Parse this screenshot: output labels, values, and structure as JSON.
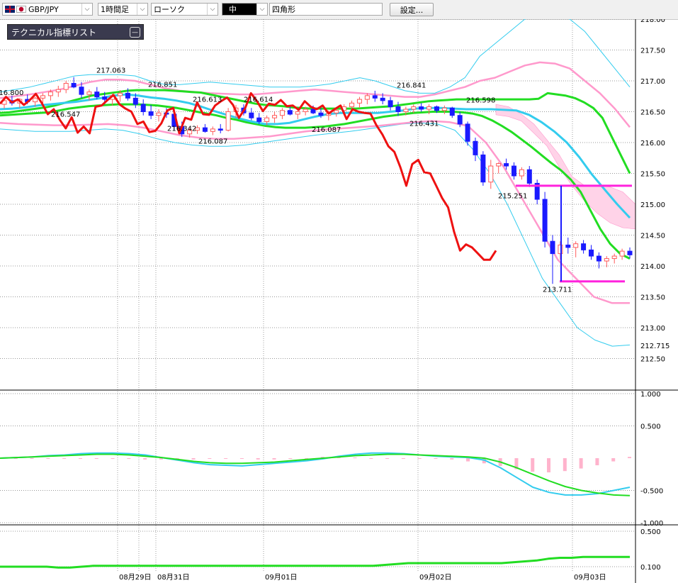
{
  "toolbar": {
    "symbol": "GBP/JPY",
    "timeframe": "1時間足",
    "chart_type": "ローソク",
    "line_style": "中",
    "drawing_tool": "四角形",
    "settings_label": "設定..."
  },
  "indicator_panel": {
    "label": "テクニカル指標リスト"
  },
  "colors": {
    "bull_candle": "#ff5a5a",
    "bear_candle": "#1a1aff",
    "red_line": "#ee1111",
    "green_line": "#22dd22",
    "cyan_line": "#33ccee",
    "pink_band": "#ff99cc",
    "magenta_marker": "#ff22dd"
  },
  "chart_data": [
    {
      "type": "candlestick",
      "title": "",
      "ylim": [
        212.5,
        218.2
      ],
      "y_ticks": [
        "218.00",
        "217.50",
        "217.00",
        "216.50",
        "216.00",
        "215.50",
        "215.00",
        "214.50",
        "214.00",
        "213.50",
        "213.00",
        "212.50"
      ],
      "current_price_label": "212.715",
      "x_labels": [
        "08月29日",
        "08月31日",
        "09月01日",
        "09月02日",
        "09月03日"
      ],
      "price_labels": [
        "216.800",
        "217.063",
        "216.547",
        "216.851",
        "216.342",
        "216.613",
        "216.087",
        "216.614",
        "216.087",
        "216.841",
        "216.431",
        "216.598",
        "215.251",
        "213.711"
      ],
      "candles": [
        [
          216.62,
          216.7,
          216.55,
          216.68
        ],
        [
          216.68,
          216.76,
          216.6,
          216.64
        ],
        [
          216.64,
          216.72,
          216.56,
          216.7
        ],
        [
          216.7,
          216.78,
          216.62,
          216.66
        ],
        [
          216.66,
          216.74,
          216.58,
          216.72
        ],
        [
          216.72,
          216.8,
          216.64,
          216.76
        ],
        [
          216.76,
          216.86,
          216.68,
          216.82
        ],
        [
          216.82,
          216.92,
          216.74,
          216.86
        ],
        [
          216.86,
          217.0,
          216.8,
          216.96
        ],
        [
          216.96,
          217.06,
          216.88,
          216.9
        ],
        [
          216.9,
          216.98,
          216.72,
          216.78
        ],
        [
          216.78,
          216.86,
          216.68,
          216.82
        ],
        [
          216.82,
          216.9,
          216.7,
          216.74
        ],
        [
          216.74,
          216.82,
          216.62,
          216.7
        ],
        [
          216.7,
          216.8,
          216.6,
          216.76
        ],
        [
          216.76,
          216.85,
          216.66,
          216.8
        ],
        [
          216.8,
          216.88,
          216.68,
          216.72
        ],
        [
          216.72,
          216.8,
          216.56,
          216.62
        ],
        [
          216.62,
          216.7,
          216.44,
          216.5
        ],
        [
          216.5,
          216.61,
          216.38,
          216.44
        ],
        [
          216.44,
          216.54,
          216.34,
          216.48
        ],
        [
          216.48,
          216.56,
          216.4,
          216.46
        ],
        [
          216.46,
          216.52,
          216.2,
          216.26
        ],
        [
          216.26,
          216.34,
          216.09,
          216.14
        ],
        [
          216.14,
          216.24,
          216.08,
          216.2
        ],
        [
          216.2,
          216.28,
          216.14,
          216.24
        ],
        [
          216.24,
          216.3,
          216.16,
          216.18
        ],
        [
          216.18,
          216.26,
          216.12,
          216.22
        ],
        [
          216.22,
          216.3,
          216.15,
          216.2
        ],
        [
          216.2,
          216.56,
          216.18,
          216.5
        ],
        [
          216.5,
          216.61,
          216.4,
          216.56
        ],
        [
          216.56,
          216.62,
          216.44,
          216.48
        ],
        [
          216.48,
          216.56,
          216.36,
          216.4
        ],
        [
          216.4,
          216.48,
          216.3,
          216.34
        ],
        [
          216.34,
          216.44,
          216.28,
          216.4
        ],
        [
          216.4,
          216.5,
          216.32,
          216.44
        ],
        [
          216.44,
          216.56,
          216.38,
          216.52
        ],
        [
          216.52,
          216.6,
          216.44,
          216.46
        ],
        [
          216.46,
          216.54,
          216.38,
          216.5
        ],
        [
          216.5,
          216.58,
          216.44,
          216.54
        ],
        [
          216.54,
          216.6,
          216.46,
          216.48
        ],
        [
          216.48,
          216.56,
          216.4,
          216.44
        ],
        [
          216.44,
          216.52,
          216.36,
          216.48
        ],
        [
          216.48,
          216.56,
          216.42,
          216.52
        ],
        [
          216.52,
          216.62,
          216.46,
          216.58
        ],
        [
          216.58,
          216.68,
          216.5,
          216.64
        ],
        [
          216.64,
          216.74,
          216.56,
          216.7
        ],
        [
          216.7,
          216.8,
          216.62,
          216.76
        ],
        [
          216.76,
          216.84,
          216.66,
          216.72
        ],
        [
          216.72,
          216.8,
          216.62,
          216.68
        ],
        [
          216.68,
          216.74,
          216.52,
          216.58
        ],
        [
          216.58,
          216.66,
          216.43,
          216.5
        ],
        [
          216.5,
          216.58,
          216.44,
          216.54
        ],
        [
          216.54,
          216.62,
          216.48,
          216.58
        ],
        [
          216.58,
          216.64,
          216.5,
          216.54
        ],
        [
          216.54,
          216.62,
          216.46,
          216.58
        ],
        [
          216.58,
          216.6,
          216.48,
          216.52
        ],
        [
          216.52,
          216.6,
          216.46,
          216.56
        ],
        [
          216.56,
          216.58,
          216.4,
          216.44
        ],
        [
          216.44,
          216.5,
          216.25,
          216.3
        ],
        [
          216.3,
          216.34,
          215.95,
          216.02
        ],
        [
          216.02,
          216.08,
          215.7,
          215.8
        ],
        [
          215.8,
          215.86,
          215.3,
          215.36
        ],
        [
          215.36,
          215.72,
          215.25,
          215.62
        ],
        [
          215.62,
          215.68,
          215.5,
          215.66
        ],
        [
          215.66,
          215.74,
          215.56,
          215.62
        ],
        [
          215.62,
          215.68,
          215.4,
          215.46
        ],
        [
          215.46,
          215.6,
          215.4,
          215.56
        ],
        [
          215.56,
          215.62,
          215.28,
          215.34
        ],
        [
          215.34,
          215.4,
          215.0,
          215.08
        ],
        [
          215.08,
          215.2,
          214.3,
          214.4
        ],
        [
          214.4,
          214.5,
          213.71,
          214.2
        ],
        [
          214.2,
          214.4,
          214.1,
          214.34
        ],
        [
          214.34,
          214.46,
          214.2,
          214.3
        ],
        [
          214.3,
          214.4,
          214.14,
          214.36
        ],
        [
          214.36,
          214.42,
          214.2,
          214.26
        ],
        [
          214.26,
          214.34,
          214.1,
          214.16
        ],
        [
          214.16,
          214.22,
          213.96,
          214.08
        ],
        [
          214.08,
          214.16,
          213.98,
          214.12
        ],
        [
          214.12,
          214.2,
          214.04,
          214.16
        ],
        [
          214.16,
          214.28,
          214.1,
          214.24
        ],
        [
          214.24,
          214.3,
          214.12,
          214.18
        ]
      ],
      "red_line": [
        216.63,
        216.74,
        216.65,
        216.7,
        216.61,
        216.69,
        216.79,
        216.64,
        216.46,
        216.54,
        216.37,
        216.23,
        216.41,
        216.16,
        216.26,
        216.15,
        216.58,
        216.6,
        216.69,
        216.77,
        216.62,
        216.55,
        216.5,
        216.3,
        216.34,
        216.17,
        216.19,
        216.31,
        216.52,
        216.56,
        216.15,
        216.4,
        216.37,
        216.65,
        216.46,
        216.45,
        216.6,
        216.67,
        216.73,
        216.61,
        216.4,
        216.55,
        216.8,
        216.67,
        216.51,
        216.63,
        216.61,
        216.69,
        216.59,
        216.6,
        216.53,
        216.67,
        216.58,
        216.54,
        216.6,
        216.47,
        216.54,
        216.6,
        216.38,
        216.54,
        216.5,
        216.48,
        216.47,
        216.28,
        216.13,
        215.94,
        215.85,
        215.6,
        215.3,
        215.65,
        215.72,
        215.52,
        215.5,
        215.3,
        215.1,
        214.95,
        214.55,
        214.25,
        214.35,
        214.3,
        214.2,
        214.1,
        214.1,
        214.25
      ],
      "green_line_1": [
        216.48,
        216.49,
        216.51,
        216.53,
        216.55,
        216.57,
        216.6,
        216.64,
        216.68,
        216.72,
        216.76,
        216.78,
        216.8,
        216.82,
        216.84,
        216.85,
        216.85,
        216.85,
        216.85,
        216.84,
        216.83,
        216.82,
        216.81,
        216.78,
        216.75,
        216.72,
        216.69,
        216.66,
        216.63,
        216.61,
        216.6,
        216.59,
        216.57,
        216.56,
        216.55,
        216.55,
        216.55,
        216.55,
        216.55,
        216.55,
        216.56,
        216.57,
        216.58,
        216.59,
        216.61,
        216.63,
        216.65,
        216.67,
        216.68,
        216.69,
        216.7,
        216.7,
        216.7,
        216.7,
        216.7,
        216.7,
        216.7,
        216.7,
        216.7,
        216.71,
        216.8,
        216.78,
        216.76,
        216.72,
        216.65,
        216.56,
        216.4,
        216.1,
        215.8,
        215.5
      ],
      "green_line_2": [
        216.44,
        216.45,
        216.46,
        216.47,
        216.48,
        216.49,
        216.52,
        216.55,
        216.57,
        216.59,
        216.6,
        216.61,
        216.62,
        216.62,
        216.62,
        216.61,
        216.6,
        216.58,
        216.56,
        216.53,
        216.5,
        216.47,
        216.44,
        216.4,
        216.37,
        216.33,
        216.3,
        216.27,
        216.25,
        216.24,
        216.24,
        216.24,
        216.25,
        216.26,
        216.28,
        216.3,
        216.33,
        216.36,
        216.39,
        216.42,
        216.44,
        216.46,
        216.48,
        216.49,
        216.5,
        216.5,
        216.5,
        216.49,
        216.47,
        216.43,
        216.36,
        216.27,
        216.17,
        216.05,
        215.93,
        215.8,
        215.67,
        215.55,
        215.4,
        215.2,
        214.9,
        214.6,
        214.36,
        214.2,
        214.12
      ],
      "cyan_line": [
        216.54,
        216.55,
        216.57,
        216.6,
        216.62,
        216.64,
        216.66,
        216.69,
        216.72,
        216.76,
        216.78,
        216.76,
        216.73,
        216.71,
        216.68,
        216.64,
        216.58,
        216.51,
        216.45,
        216.39,
        216.34,
        216.3,
        216.3,
        216.32,
        216.37,
        216.42,
        216.46,
        216.48,
        216.48,
        216.48,
        216.48,
        216.5,
        216.52,
        216.55,
        216.56,
        216.56,
        216.55,
        216.54,
        216.54,
        216.54,
        216.53,
        216.52,
        216.45,
        216.33,
        216.18,
        216.0,
        215.76,
        215.48,
        215.24,
        215.0,
        214.78
      ],
      "bb_upper_cyan": [
        216.82,
        216.86,
        216.9,
        216.96,
        217.02,
        217.08,
        217.1,
        217.1,
        217.1,
        217.08,
        217.0,
        216.94,
        216.94,
        216.96,
        216.98,
        216.96,
        216.94,
        216.92,
        216.9,
        216.9,
        216.9,
        216.92,
        216.95,
        217.0,
        217.05,
        217.0,
        216.92,
        216.84,
        216.8,
        216.8,
        216.9,
        217.05,
        217.4,
        217.6,
        217.8,
        218.0,
        218.05,
        218.05,
        218.0,
        217.8,
        217.5,
        217.2,
        216.9
      ],
      "bb_upper_pink": [
        216.72,
        216.75,
        216.78,
        216.82,
        216.86,
        216.92,
        216.98,
        217.02,
        217.02,
        217.0,
        216.94,
        216.88,
        216.84,
        216.82,
        216.8,
        216.79,
        216.78,
        216.78,
        216.8,
        216.82,
        216.84,
        216.86,
        216.84,
        216.82,
        216.8,
        216.78,
        216.76,
        216.74,
        216.74,
        216.78,
        216.84,
        216.9,
        217.0,
        217.05,
        217.15,
        217.25,
        217.3,
        217.28,
        217.2,
        217.0,
        216.8,
        216.55,
        216.25
      ],
      "bb_lower_cyan": [
        216.22,
        216.2,
        216.18,
        216.18,
        216.18,
        216.2,
        216.22,
        216.2,
        216.14,
        216.06,
        216.0,
        215.96,
        215.94,
        215.94,
        215.96,
        216.0,
        216.04,
        216.08,
        216.12,
        216.15,
        216.18,
        216.22,
        216.26,
        216.3,
        216.32,
        216.3,
        216.2,
        215.9,
        215.5,
        215.0,
        214.4,
        213.8,
        213.4,
        213.0,
        212.8,
        212.7,
        212.72
      ],
      "bb_lower_pink": [
        216.32,
        216.3,
        216.29,
        216.28,
        216.28,
        216.29,
        216.3,
        216.28,
        216.24,
        216.18,
        216.12,
        216.08,
        216.06,
        216.06,
        216.08,
        216.1,
        216.14,
        216.18,
        216.21,
        216.23,
        216.25,
        216.27,
        216.3,
        216.33,
        216.35,
        216.33,
        216.27,
        216.0,
        215.6,
        215.1,
        214.6,
        214.1,
        213.8,
        213.5,
        213.4,
        213.4
      ],
      "rectangles": [
        {
          "from_price": 215.3,
          "note_price": 215.251
        },
        {
          "from_price": 213.75,
          "note_price": 213.711
        }
      ]
    },
    {
      "type": "line",
      "title": "",
      "ylim": [
        -1.15,
        1.0
      ],
      "y_ticks": [
        "1.000",
        "0.500",
        "-0.500",
        "-1.000"
      ],
      "series": [
        {
          "values": [
            0.0,
            0.01,
            0.02,
            0.04,
            0.05,
            0.07,
            0.08,
            0.08,
            0.07,
            0.05,
            0.01,
            -0.03,
            -0.07,
            -0.1,
            -0.11,
            -0.12,
            -0.1,
            -0.08,
            -0.06,
            -0.04,
            -0.01,
            0.03,
            0.06,
            0.08,
            0.08,
            0.07,
            0.05,
            0.03,
            0.02,
            0.01,
            -0.03,
            -0.15,
            -0.3,
            -0.45,
            -0.53,
            -0.57,
            -0.57,
            -0.55,
            -0.5,
            -0.45
          ]
        },
        {
          "values": [
            0.0,
            0.01,
            0.02,
            0.03,
            0.04,
            0.05,
            0.06,
            0.06,
            0.05,
            0.03,
            0.01,
            -0.02,
            -0.05,
            -0.07,
            -0.08,
            -0.08,
            -0.07,
            -0.06,
            -0.04,
            -0.02,
            0.0,
            0.02,
            0.04,
            0.05,
            0.06,
            0.06,
            0.05,
            0.04,
            0.03,
            0.02,
            0.0,
            -0.06,
            -0.15,
            -0.25,
            -0.35,
            -0.44,
            -0.5,
            -0.54,
            -0.57,
            -0.58
          ]
        },
        {
          "values": [
            0.0,
            0.0,
            0.0,
            0.0,
            0.0,
            0.0,
            0.0,
            0.0,
            -0.01,
            -0.02,
            -0.02,
            -0.02,
            -0.02,
            -0.01,
            0.0,
            -0.01,
            -0.02,
            -0.02,
            -0.01,
            0.0,
            0.02,
            0.02,
            0.01,
            0.0,
            0.0,
            0.0,
            0.0,
            -0.01,
            -0.02,
            -0.05,
            -0.08,
            -0.12,
            -0.17,
            -0.21,
            -0.22,
            -0.2,
            -0.16,
            -0.11,
            -0.05,
            0.02
          ]
        }
      ]
    },
    {
      "type": "line",
      "title": "",
      "ylim": [
        0.08,
        0.5
      ],
      "y_ticks": [
        "0.500",
        "0.100"
      ],
      "series": [
        {
          "values": [
            0.1,
            0.1,
            0.1,
            0.1,
            0.1,
            0.09,
            0.09,
            0.1,
            0.11,
            0.11,
            0.11,
            0.11,
            0.11,
            0.11,
            0.11,
            0.11,
            0.11,
            0.11,
            0.11,
            0.11,
            0.11,
            0.11,
            0.11,
            0.11,
            0.11,
            0.11,
            0.11,
            0.11,
            0.11,
            0.11,
            0.11,
            0.11,
            0.11,
            0.12,
            0.13,
            0.14,
            0.14,
            0.14,
            0.14,
            0.14,
            0.14,
            0.14,
            0.14,
            0.14,
            0.15,
            0.16,
            0.17,
            0.19,
            0.2,
            0.2,
            0.21,
            0.21,
            0.21,
            0.21,
            0.21
          ]
        }
      ]
    }
  ]
}
